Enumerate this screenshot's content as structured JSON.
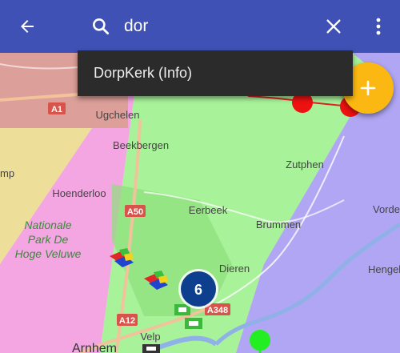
{
  "search": {
    "query": "dor",
    "suggestion": "DorpKerk (Info)"
  },
  "icons": {
    "back": "arrow-left-icon",
    "search": "search-icon",
    "clear": "close-icon",
    "menu": "more-vertical-icon",
    "fab": "plus-icon"
  },
  "colors": {
    "toolbar": "#3f51b5",
    "fab": "#fbb812",
    "suggestion_bg": "#2b2b2b",
    "zone_green": "#9ef28a",
    "zone_blue": "#a89cf2",
    "zone_pink": "#f4a6e3",
    "zone_yellow": "#eddf9a",
    "zone_red": "#d9928a",
    "route": "#e02020"
  },
  "map": {
    "places": {
      "ugchelen": "Ugchelen",
      "beekbergen": "Beekbergen",
      "zutphen": "Zutphen",
      "hoenderloo": "Hoenderloo",
      "eerbeek": "Eerbeek",
      "brummen": "Brummen",
      "vorden": "Vorde",
      "hengelo": "Hengel",
      "dieren": "Dieren",
      "velp": "Velp",
      "arnhem": "Arnhem",
      "apeldoorn_partial": "mp"
    },
    "park_lines": [
      "Nationale",
      "Park De",
      "Hoge Veluwe"
    ],
    "roads": {
      "a1": "A1",
      "a50": "A50",
      "a12": "A12",
      "a348": "A348"
    },
    "cluster_count": "6"
  }
}
